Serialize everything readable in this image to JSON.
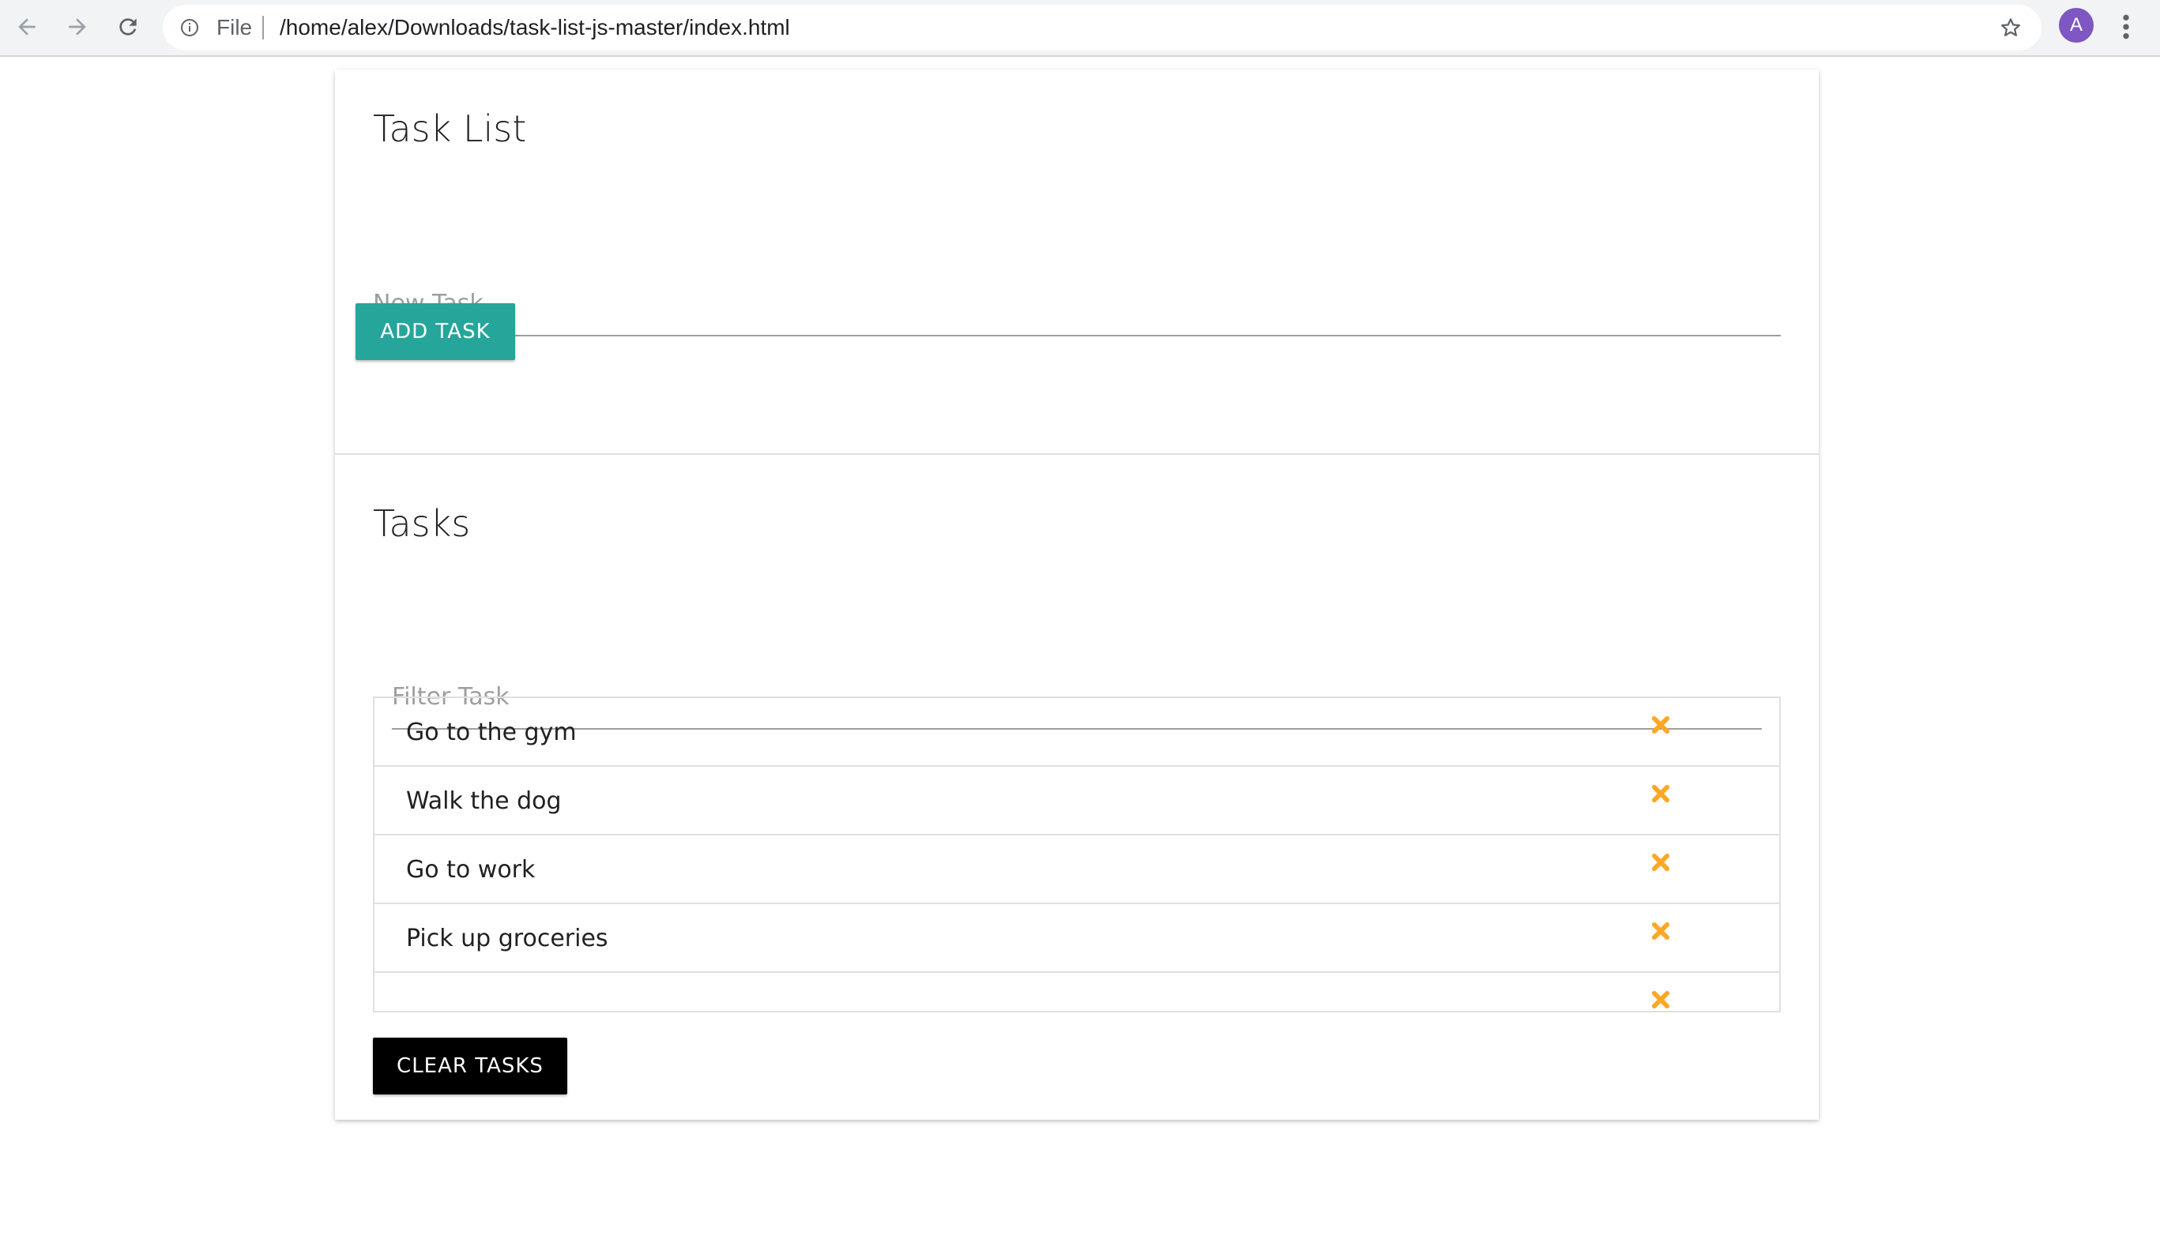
{
  "browser": {
    "scheme_label": "File",
    "url": "/home/alex/Downloads/task-list-js-master/index.html",
    "avatar_letter": "A",
    "icons": {
      "back": "arrow-left-icon",
      "forward": "arrow-right-icon",
      "reload": "reload-icon",
      "info": "info-icon",
      "bookmark": "star-icon",
      "menu": "kebab-menu-icon"
    },
    "colors": {
      "avatar": "#7e57c2"
    }
  },
  "page": {
    "title": "Task List",
    "new_task_placeholder": "New Task",
    "new_task_value": "",
    "add_button_label": "ADD TASK",
    "tasks_title": "Tasks",
    "filter_placeholder": "Filter Task",
    "filter_value": "",
    "tasks": [
      {
        "text": "Go to the gym"
      },
      {
        "text": "Walk the dog"
      },
      {
        "text": "Go to work"
      },
      {
        "text": "Pick up groceries"
      },
      {
        "text": ""
      }
    ],
    "clear_button_label": "CLEAR TASKS",
    "colors": {
      "add_button": "#26a69a",
      "clear_button": "#000000",
      "delete_icon": "#ffa726"
    }
  }
}
